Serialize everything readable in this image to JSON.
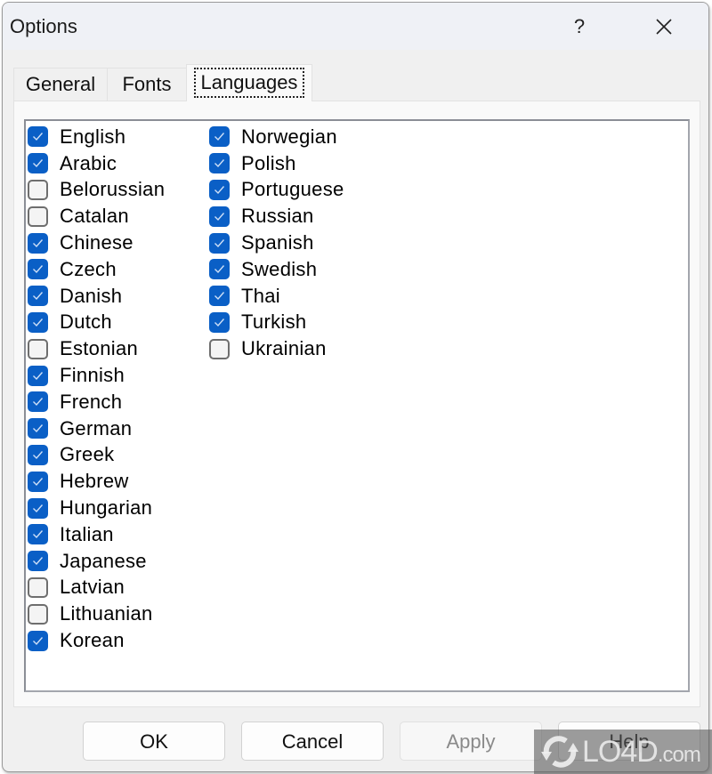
{
  "window": {
    "title": "Options",
    "help_label": "?",
    "close_icon": "close-icon"
  },
  "tabs": [
    {
      "label": "General",
      "active": false
    },
    {
      "label": "Fonts",
      "active": false
    },
    {
      "label": "Languages",
      "active": true
    }
  ],
  "languages": {
    "left": [
      {
        "label": "English",
        "checked": true
      },
      {
        "label": "Arabic",
        "checked": true
      },
      {
        "label": "Belorussian",
        "checked": false
      },
      {
        "label": "Catalan",
        "checked": false
      },
      {
        "label": "Chinese",
        "checked": true
      },
      {
        "label": "Czech",
        "checked": true
      },
      {
        "label": "Danish",
        "checked": true
      },
      {
        "label": "Dutch",
        "checked": true
      },
      {
        "label": "Estonian",
        "checked": false
      },
      {
        "label": "Finnish",
        "checked": true
      },
      {
        "label": "French",
        "checked": true
      },
      {
        "label": "German",
        "checked": true
      },
      {
        "label": "Greek",
        "checked": true
      },
      {
        "label": "Hebrew",
        "checked": true
      },
      {
        "label": "Hungarian",
        "checked": true
      },
      {
        "label": "Italian",
        "checked": true
      },
      {
        "label": "Japanese",
        "checked": true
      },
      {
        "label": "Latvian",
        "checked": false
      },
      {
        "label": "Lithuanian",
        "checked": false
      },
      {
        "label": "Korean",
        "checked": true
      }
    ],
    "right": [
      {
        "label": "Norwegian",
        "checked": true
      },
      {
        "label": "Polish",
        "checked": true
      },
      {
        "label": "Portuguese",
        "checked": true
      },
      {
        "label": "Russian",
        "checked": true
      },
      {
        "label": "Spanish",
        "checked": true
      },
      {
        "label": "Swedish",
        "checked": true
      },
      {
        "label": "Thai",
        "checked": true
      },
      {
        "label": "Turkish",
        "checked": true
      },
      {
        "label": "Ukrainian",
        "checked": false
      }
    ]
  },
  "buttons": {
    "ok": "OK",
    "cancel": "Cancel",
    "apply": "Apply",
    "help": "Help"
  },
  "watermark": {
    "text_main": "LO4D",
    "text_suffix": ".com"
  },
  "colors": {
    "checkbox_accent": "#0a5fc6"
  }
}
